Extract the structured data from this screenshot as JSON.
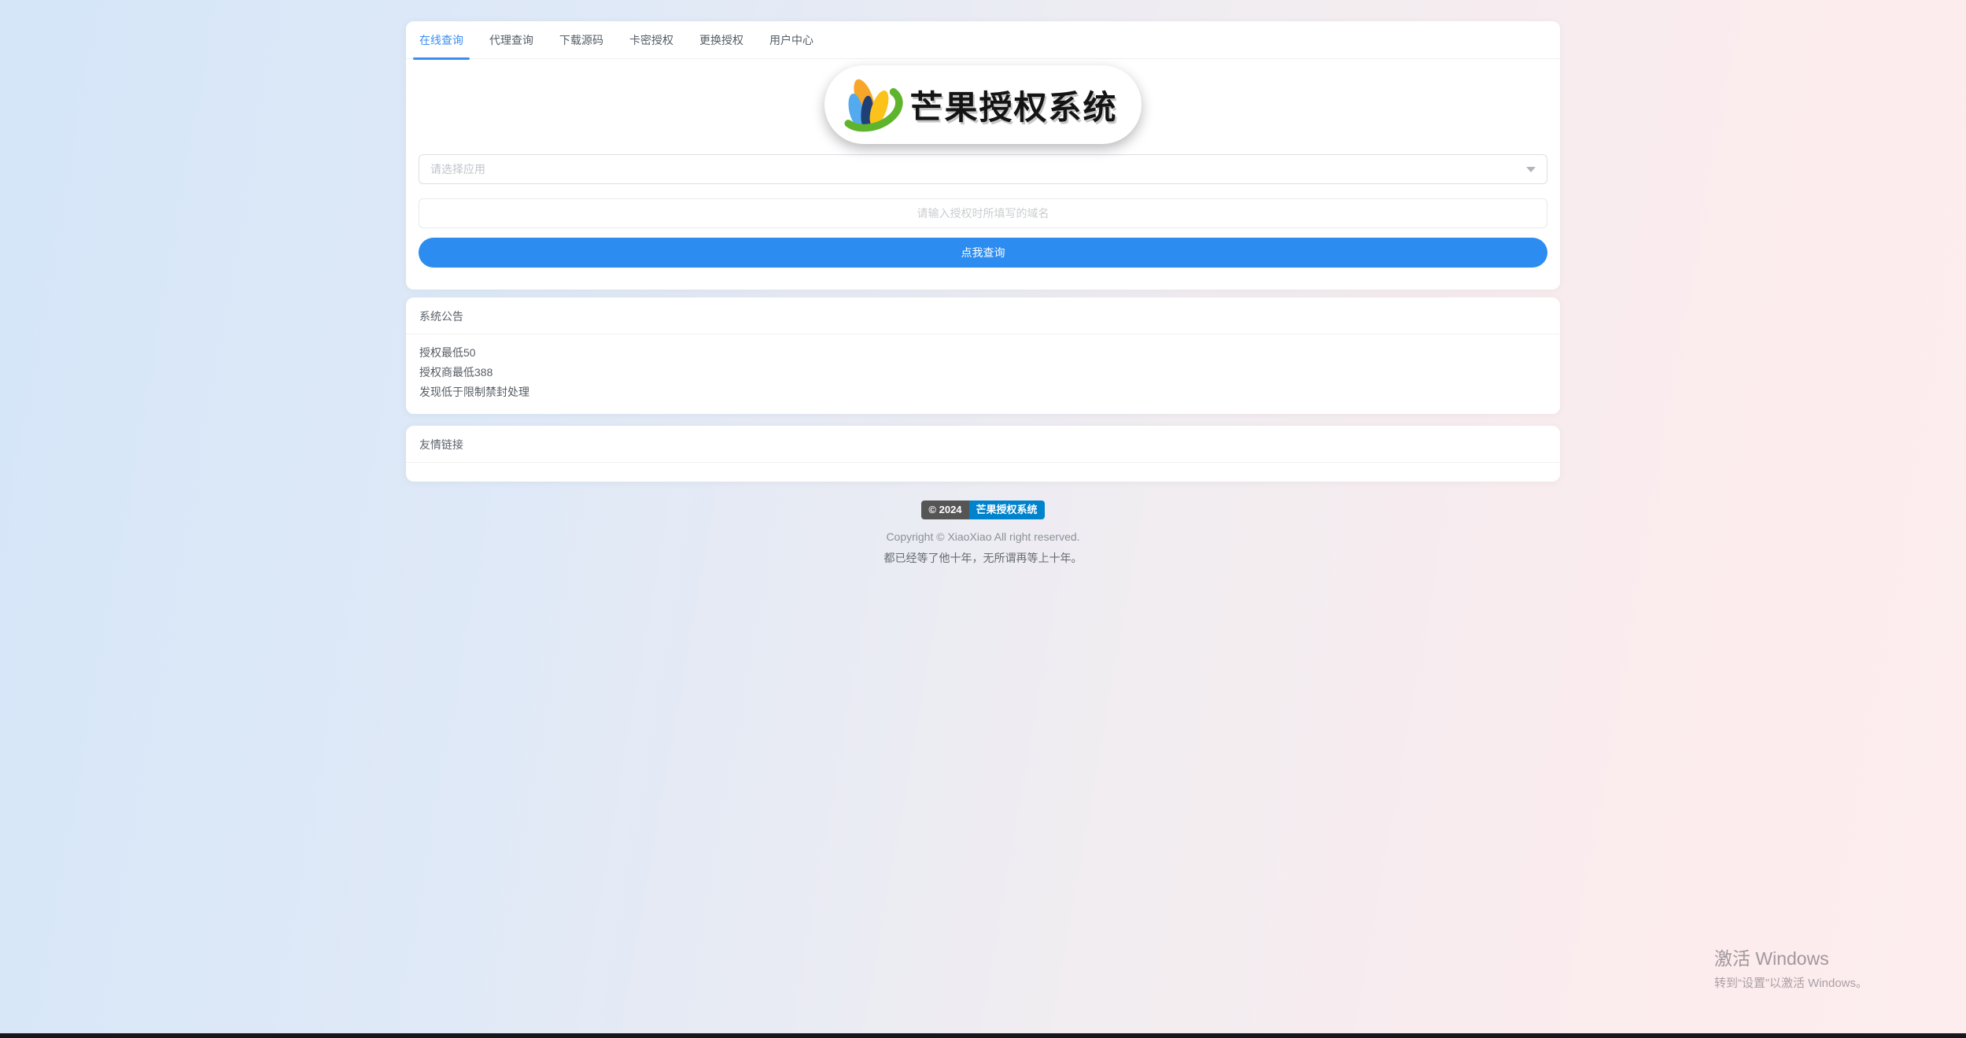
{
  "nav": {
    "tabs": [
      {
        "label": "在线查询",
        "active": true
      },
      {
        "label": "代理查询",
        "active": false
      },
      {
        "label": "下载源码",
        "active": false
      },
      {
        "label": "卡密授权",
        "active": false
      },
      {
        "label": "更换授权",
        "active": false
      },
      {
        "label": "用户中心",
        "active": false
      }
    ]
  },
  "logo": {
    "title": "芒果授权系统",
    "icon": "mango-logo-icon"
  },
  "form": {
    "select_placeholder": "请选择应用",
    "domain_placeholder": "请输入授权时所填写的域名",
    "submit_label": "点我查询"
  },
  "announcement": {
    "title": "系统公告",
    "lines": [
      "授权最低50",
      "授权商最低388",
      "发现低于限制禁封处理"
    ]
  },
  "links": {
    "title": "友情链接"
  },
  "footer": {
    "badge_year": "© 2024",
    "badge_name": "芒果授权系统",
    "copyright": "Copyright © XiaoXiao All right reserved.",
    "tagline": "都已经等了他十年，无所谓再等上十年。"
  },
  "watermark": {
    "line1": "激活 Windows",
    "line2": "转到“设置”以激活 Windows。"
  },
  "colors": {
    "accent_blue": "#2d8cf0",
    "tab_active_blue": "#3b8ef0",
    "badge_dark": "#555555",
    "badge_blue": "#0083cd",
    "bg_gradient_left": "#d5e6f9",
    "bg_gradient_right": "#fdedee"
  }
}
